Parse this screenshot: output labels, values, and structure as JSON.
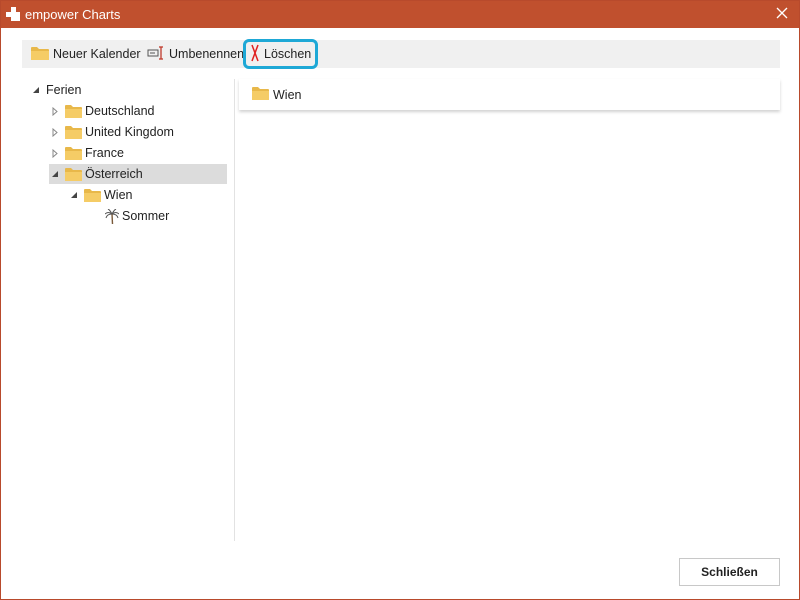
{
  "window": {
    "title": "empower Charts",
    "accent_color": "#c0502e",
    "close_icon": "close-icon"
  },
  "toolbar": {
    "buttons": [
      {
        "label": "Neuer Kalender",
        "icon": "folder-icon"
      },
      {
        "label": "Umbenennen",
        "icon": "rename-icon"
      },
      {
        "label": "Löschen",
        "icon": "delete-icon",
        "highlighted": true,
        "highlight_color": "#1ea8d6"
      }
    ]
  },
  "tree": {
    "root": {
      "label": "Ferien",
      "expanded": true
    },
    "items": [
      {
        "label": "Deutschland",
        "expanded": false,
        "icon": "folder-icon"
      },
      {
        "label": "United Kingdom",
        "expanded": false,
        "icon": "folder-icon"
      },
      {
        "label": "France",
        "expanded": false,
        "icon": "folder-icon"
      },
      {
        "label": "Österreich",
        "expanded": true,
        "selected": true,
        "icon": "folder-icon"
      },
      {
        "label": "Wien",
        "expanded": true,
        "icon": "folder-icon"
      },
      {
        "label": "Sommer",
        "icon": "palm-tree-icon"
      }
    ]
  },
  "content": {
    "items": [
      {
        "label": "Wien",
        "icon": "folder-icon"
      }
    ]
  },
  "footer": {
    "close_label": "Schließen"
  }
}
